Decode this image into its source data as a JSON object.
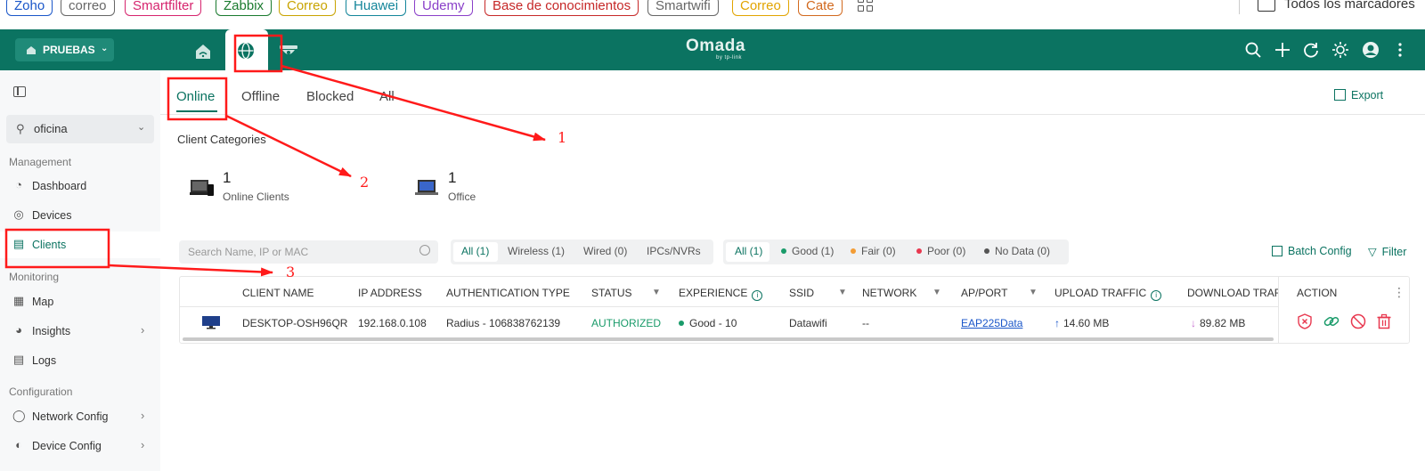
{
  "bookmarks": [
    {
      "label": "Zoho",
      "color": "#1a56c9"
    },
    {
      "label": "correo",
      "color": "#666666"
    },
    {
      "label": "Smartfilter",
      "color": "#d6246e"
    },
    {
      "label": "Zabbix",
      "color": "#1a7a2e"
    },
    {
      "label": "Correo",
      "color": "#c8a300"
    },
    {
      "label": "Huawei",
      "color": "#13859a"
    },
    {
      "label": "Udemy",
      "color": "#8a3fc9"
    },
    {
      "label": "Base de conocimientos",
      "color": "#c62828"
    },
    {
      "label": "Smartwifi",
      "color": "#666666"
    },
    {
      "label": "Correo",
      "color": "#e2a400"
    },
    {
      "label": "Cate",
      "color": "#d2691e"
    }
  ],
  "all_bookmarks_label": "Todos los marcadores",
  "header": {
    "site_button": "PRUEBAS",
    "logo": "Omada",
    "logo_sub": "by tp-link"
  },
  "sidebar": {
    "site_select": "oficina",
    "sections": {
      "management": "Management",
      "monitoring": "Monitoring",
      "configuration": "Configuration"
    },
    "items": {
      "dashboard": "Dashboard",
      "devices": "Devices",
      "clients": "Clients",
      "map": "Map",
      "insights": "Insights",
      "logs": "Logs",
      "network_config": "Network Config",
      "device_config": "Device Config"
    }
  },
  "tabs": [
    "Online",
    "Offline",
    "Blocked",
    "All"
  ],
  "export_label": "Export",
  "client_categories": {
    "title": "Client Categories",
    "items": [
      {
        "count": "1",
        "label": "Online Clients"
      },
      {
        "count": "1",
        "label": "Office"
      }
    ]
  },
  "search_placeholder": "Search Name, IP or MAC",
  "type_filter": [
    "All (1)",
    "Wireless (1)",
    "Wired (0)",
    "IPCs/NVRs"
  ],
  "experience_filter": [
    "All (1)",
    "Good (1)",
    "Fair (0)",
    "Poor (0)",
    "No Data (0)"
  ],
  "experience_colors": {
    "good": "#1a9b6a",
    "fair": "#f39c34",
    "poor": "#e8384f",
    "nodata": "#555555"
  },
  "batch_config_label": "Batch Config",
  "filter_label": "Filter",
  "table": {
    "headers": {
      "client_name": "CLIENT NAME",
      "ip": "IP ADDRESS",
      "auth": "AUTHENTICATION TYPE",
      "status": "STATUS",
      "experience": "EXPERIENCE",
      "ssid": "SSID",
      "network": "NETWORK",
      "ap_port": "AP/PORT",
      "upload": "UPLOAD TRAFFIC",
      "download": "DOWNLOAD TRAFFI",
      "action": "ACTION"
    },
    "row": {
      "client_name": "DESKTOP-OSH96QR",
      "ip": "192.168.0.108",
      "auth": "Radius - 106838762139",
      "status": "AUTHORIZED",
      "experience": "Good - 10",
      "ssid": "Datawifi",
      "network": "--",
      "ap_port": "EAP225Data",
      "upload": "14.60 MB",
      "download": "89.82 MB"
    }
  },
  "annotations": [
    "1",
    "2",
    "3"
  ],
  "colors": {
    "brand": "#0b7361",
    "annotation": "#ff1a1a"
  }
}
